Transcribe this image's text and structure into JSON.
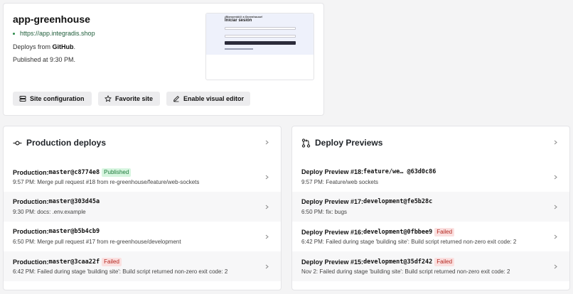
{
  "site": {
    "title": "app-greenhouse",
    "url": "https://app.integradis.shop",
    "deploys_from_prefix": "Deploys from ",
    "deploys_from_source": "GitHub",
    "deploys_from_suffix": ".",
    "published": "Published at 9:30 PM.",
    "preview": {
      "line1": "¡Bienvenid@ a Greenhouse!",
      "line2": "Iniciar sesión"
    }
  },
  "actions": {
    "site_config": "Site configuration",
    "favorite": "Favorite site",
    "visual_editor": "Enable visual editor"
  },
  "production": {
    "title": "Production deploys",
    "rows": [
      {
        "prefix": "Production: ",
        "ref": "master@c8774e8",
        "badge": "Published",
        "badge_type": "ok",
        "detail": "9:57 PM: Merge pull request #18 from re-greenhouse/feature/web-sockets"
      },
      {
        "prefix": "Production: ",
        "ref": "master@303d45a",
        "badge": "",
        "badge_type": "",
        "detail": "9:30 PM: docs: .env.example"
      },
      {
        "prefix": "Production: ",
        "ref": "master@b5b4cb9",
        "badge": "",
        "badge_type": "",
        "detail": "6:50 PM: Merge pull request #17 from re-greenhouse/development"
      },
      {
        "prefix": "Production: ",
        "ref": "master@3caa22f",
        "badge": "Failed",
        "badge_type": "fail",
        "detail": "6:42 PM: Failed during stage 'building site': Build script returned non-zero exit code: 2"
      }
    ]
  },
  "previews": {
    "title": "Deploy Previews",
    "rows": [
      {
        "prefix": "Deploy Preview #18: ",
        "ref": "feature/we… @63d0c86",
        "badge": "",
        "badge_type": "",
        "detail": "9:57 PM: Feature/web sockets"
      },
      {
        "prefix": "Deploy Preview #17: ",
        "ref": "development@fe5b28c",
        "badge": "",
        "badge_type": "",
        "detail": "6:50 PM: fix: bugs"
      },
      {
        "prefix": "Deploy Preview #16: ",
        "ref": "development@0fbbee9",
        "badge": "Failed",
        "badge_type": "fail",
        "detail": "6:42 PM: Failed during stage 'building site': Build script returned non-zero exit code: 2"
      },
      {
        "prefix": "Deploy Preview #15: ",
        "ref": "development@35df242",
        "badge": "Failed",
        "badge_type": "fail",
        "detail": "Nov 2: Failed during stage 'building site': Build script returned non-zero exit code: 2"
      }
    ]
  },
  "colors": {
    "accent_green": "#1f7a3a",
    "published_bg": "#d6f5df",
    "failed_bg": "#fbe0e0",
    "failed_text": "#b3261e"
  }
}
